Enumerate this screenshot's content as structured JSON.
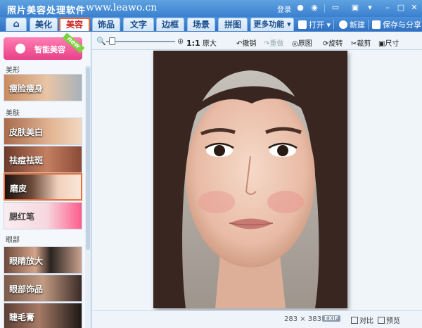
{
  "window": {
    "title": "照片美容处理软件",
    "watermark": "www.leawo.cn",
    "login": "登录"
  },
  "tabs": [
    {
      "label": "美化"
    },
    {
      "label": "美容"
    },
    {
      "label": "饰品"
    },
    {
      "label": "文字"
    },
    {
      "label": "边框"
    },
    {
      "label": "场景"
    },
    {
      "label": "拼图"
    },
    {
      "label": "更多功能 ▾"
    }
  ],
  "actions": {
    "open": "打开 ▾",
    "new": "新建",
    "save": "保存与分享"
  },
  "left_panel": {
    "smart_button": "智能美容",
    "new_badge": "new",
    "sections": [
      {
        "label": "美形"
      },
      {
        "label": "美肤"
      },
      {
        "label": "眼部"
      }
    ],
    "features": [
      {
        "label": "瘦脸瘦身"
      },
      {
        "label": "皮肤美白"
      },
      {
        "label": "祛痘祛斑"
      },
      {
        "label": "磨皮"
      },
      {
        "label": "腮红笔"
      },
      {
        "label": "眼睛放大"
      },
      {
        "label": "眼部饰品"
      },
      {
        "label": "睫毛膏"
      }
    ]
  },
  "canvas_toolbar": {
    "ratio": "1:1",
    "original_size": "原大",
    "undo": "撤销",
    "redo": "重做",
    "original": "原图",
    "rotate": "旋转",
    "crop": "裁剪",
    "size": "尺寸"
  },
  "status": {
    "width": "283",
    "times": "×",
    "height": "383",
    "exif": "EXIF",
    "compare": "对比",
    "preview": "预览"
  },
  "colors": {
    "accent": "#e86a3c",
    "title_bar": "#3a80cf",
    "smart_button": "#e94088"
  }
}
